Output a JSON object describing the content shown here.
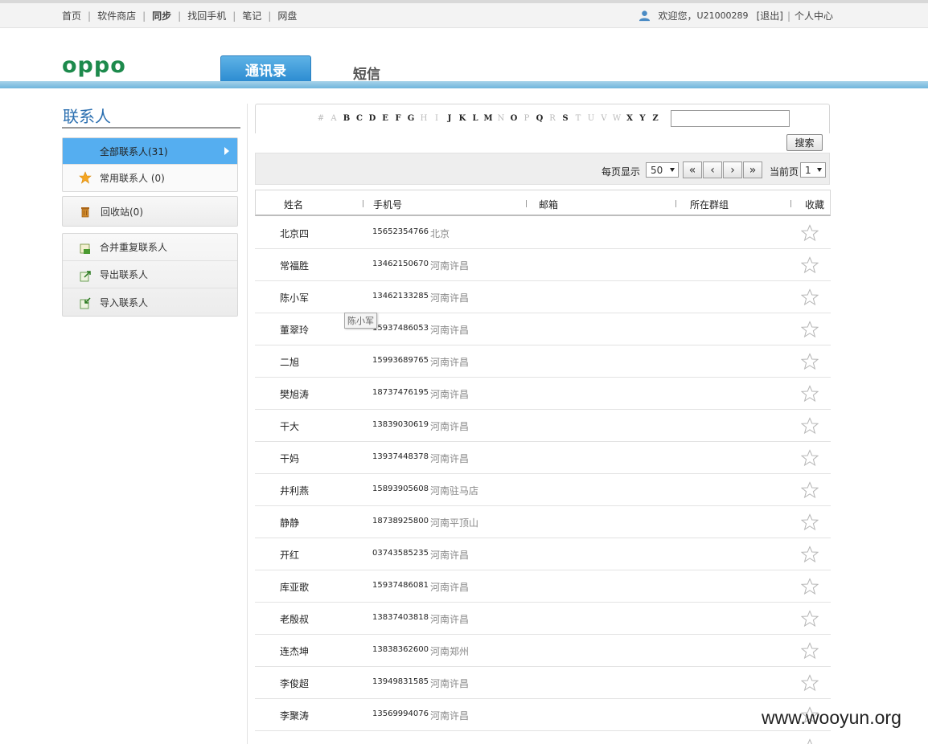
{
  "topnav": {
    "items": [
      {
        "label": "首页",
        "bold": false
      },
      {
        "label": "软件商店",
        "bold": false
      },
      {
        "label": "同步",
        "bold": true
      },
      {
        "label": "找回手机",
        "bold": false
      },
      {
        "label": "笔记",
        "bold": false
      },
      {
        "label": "网盘",
        "bold": false
      }
    ],
    "welcome": "欢迎您，",
    "username": "U21000289",
    "logout": "[退出]",
    "user_center": "个人中心"
  },
  "header": {
    "logo_text": "oppo",
    "tabs": [
      {
        "label": "通讯录",
        "active": true
      },
      {
        "label": "短信",
        "active": false
      }
    ],
    "accent_color": "#2b8bd1"
  },
  "sidebar": {
    "title": "联系人",
    "group1": [
      {
        "label": "全部联系人(31)",
        "icon": "none",
        "active": true
      },
      {
        "label": "常用联系人 (0)",
        "icon": "star-icon",
        "active": false
      }
    ],
    "group2": [
      {
        "label": "回收站(0)",
        "icon": "trash-icon"
      }
    ],
    "group3": [
      {
        "label": "合并重复联系人",
        "icon": "merge-icon"
      },
      {
        "label": "导出联系人",
        "icon": "export-icon"
      },
      {
        "label": "导入联系人",
        "icon": "import-icon"
      }
    ]
  },
  "alphabet": [
    {
      "ch": "#",
      "on": false
    },
    {
      "ch": "A",
      "on": false
    },
    {
      "ch": "B",
      "on": true
    },
    {
      "ch": "C",
      "on": true
    },
    {
      "ch": "D",
      "on": true
    },
    {
      "ch": "E",
      "on": true
    },
    {
      "ch": "F",
      "on": true
    },
    {
      "ch": "G",
      "on": true
    },
    {
      "ch": "H",
      "on": false
    },
    {
      "ch": "I",
      "on": false
    },
    {
      "ch": "J",
      "on": true
    },
    {
      "ch": "K",
      "on": true
    },
    {
      "ch": "L",
      "on": true
    },
    {
      "ch": "M",
      "on": true
    },
    {
      "ch": "N",
      "on": false
    },
    {
      "ch": "O",
      "on": true
    },
    {
      "ch": "P",
      "on": false
    },
    {
      "ch": "Q",
      "on": true
    },
    {
      "ch": "R",
      "on": false
    },
    {
      "ch": "S",
      "on": true
    },
    {
      "ch": "T",
      "on": false
    },
    {
      "ch": "U",
      "on": false
    },
    {
      "ch": "V",
      "on": false
    },
    {
      "ch": "W",
      "on": false
    },
    {
      "ch": "X",
      "on": true
    },
    {
      "ch": "Y",
      "on": true
    },
    {
      "ch": "Z",
      "on": true
    }
  ],
  "search": {
    "value": "",
    "button_label": "搜索"
  },
  "pager": {
    "per_page_label": "每页显示",
    "per_page_value": "50",
    "current_page_label": "当前页",
    "current_page_value": "1",
    "first": "«",
    "prev": "‹",
    "next": "›",
    "last": "»"
  },
  "table": {
    "columns": {
      "name": "姓名",
      "phone": "手机号",
      "email": "邮箱",
      "group": "所在群组",
      "fav": "收藏"
    },
    "rows": [
      {
        "name": "北京四",
        "phone": "15652354766",
        "loc": "北京"
      },
      {
        "name": "常福胜",
        "phone": "13462150670",
        "loc": "河南许昌"
      },
      {
        "name": "陈小军",
        "phone": "13462133285",
        "loc": "河南许昌"
      },
      {
        "name": "董翠玲",
        "phone": "15937486053",
        "loc": "河南许昌"
      },
      {
        "name": "二旭",
        "phone": "15993689765",
        "loc": "河南许昌"
      },
      {
        "name": "樊旭涛",
        "phone": "18737476195",
        "loc": "河南许昌"
      },
      {
        "name": "干大",
        "phone": "13839030619",
        "loc": "河南许昌"
      },
      {
        "name": "干妈",
        "phone": "13937448378",
        "loc": "河南许昌"
      },
      {
        "name": "井利燕",
        "phone": "15893905608",
        "loc": "河南驻马店"
      },
      {
        "name": "静静",
        "phone": "18738925800",
        "loc": "河南平顶山"
      },
      {
        "name": "开红",
        "phone": "03743585235",
        "loc": "河南许昌"
      },
      {
        "name": "库亚歌",
        "phone": "15937486081",
        "loc": "河南许昌"
      },
      {
        "name": "老殷叔",
        "phone": "13837403818",
        "loc": "河南许昌"
      },
      {
        "name": "连杰坤",
        "phone": "13838362600",
        "loc": "河南郑州"
      },
      {
        "name": "李俊超",
        "phone": "13949831585",
        "loc": "河南许昌"
      },
      {
        "name": "李聚涛",
        "phone": "13569994076",
        "loc": "河南许昌"
      },
      {
        "name": "",
        "phone": "",
        "loc": ""
      }
    ]
  },
  "tooltip": "陈小军",
  "watermark": "www.wooyun.org"
}
